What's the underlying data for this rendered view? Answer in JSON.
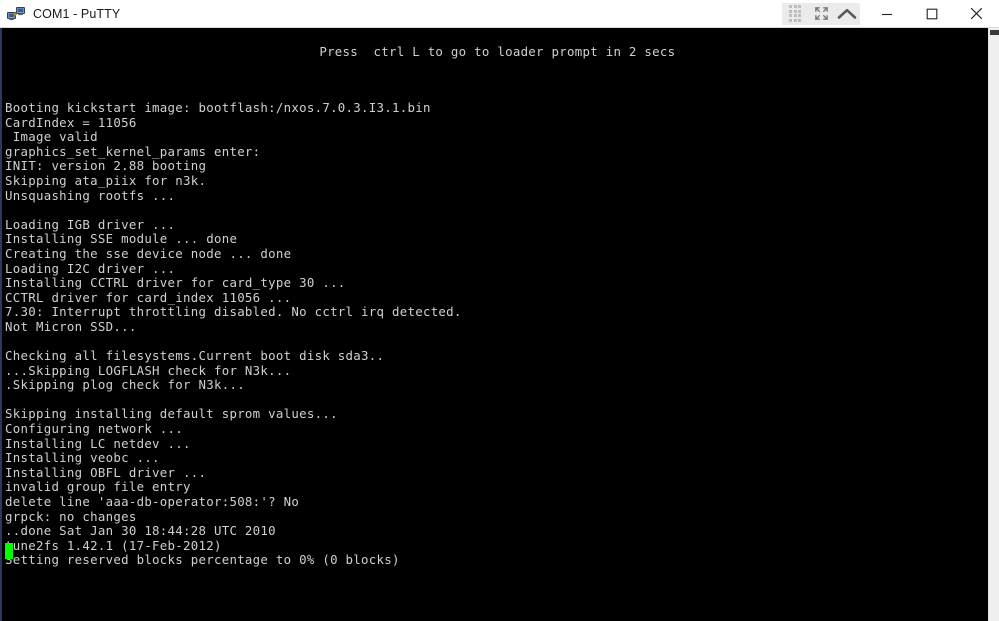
{
  "window": {
    "title": "COM1 - PuTTY",
    "icon": "putty-network-icon",
    "controls": {
      "minimize_label": "–",
      "maximize_label": "□",
      "close_label": "✕"
    },
    "capture_tools": {
      "dots_label": "dots-grid-icon",
      "expand_label": "expand-arrows-icon",
      "collapse_label": "chevron-up-icon"
    }
  },
  "terminal": {
    "notice": "                                         Press  ctrl L to go to loader prompt in 2 secs",
    "cursor": "block-cursor",
    "cursor_color": "#00ff00",
    "background_color": "#000000",
    "text_color": "#d0d0d0",
    "lines": [
      "Booting kickstart image: bootflash:/nxos.7.0.3.I3.1.bin",
      "CardIndex = 11056",
      " Image valid",
      "graphics_set_kernel_params enter:",
      "INIT: version 2.88 booting",
      "Skipping ata_piix for n3k.",
      "Unsquashing rootfs ...",
      "",
      "Loading IGB driver ...",
      "Installing SSE module ... done",
      "Creating the sse device node ... done",
      "Loading I2C driver ...",
      "Installing CCTRL driver for card_type 30 ...",
      "CCTRL driver for card_index 11056 ...",
      "7.30: Interrupt throttling disabled. No cctrl irq detected.",
      "Not Micron SSD...",
      "",
      "Checking all filesystems.Current boot disk sda3..",
      "...Skipping LOGFLASH check for N3k...",
      ".Skipping plog check for N3k...",
      "",
      "Skipping installing default sprom values...",
      "Configuring network ...",
      "Installing LC netdev ...",
      "Installing veobc ...",
      "Installing OBFL driver ...",
      "invalid group file entry",
      "delete line 'aaa-db-operator:508:'? No",
      "grpck: no changes",
      "..done Sat Jan 30 18:44:28 UTC 2010",
      "tune2fs 1.42.1 (17-Feb-2012)",
      "Setting reserved blocks percentage to 0% (0 blocks)"
    ]
  }
}
